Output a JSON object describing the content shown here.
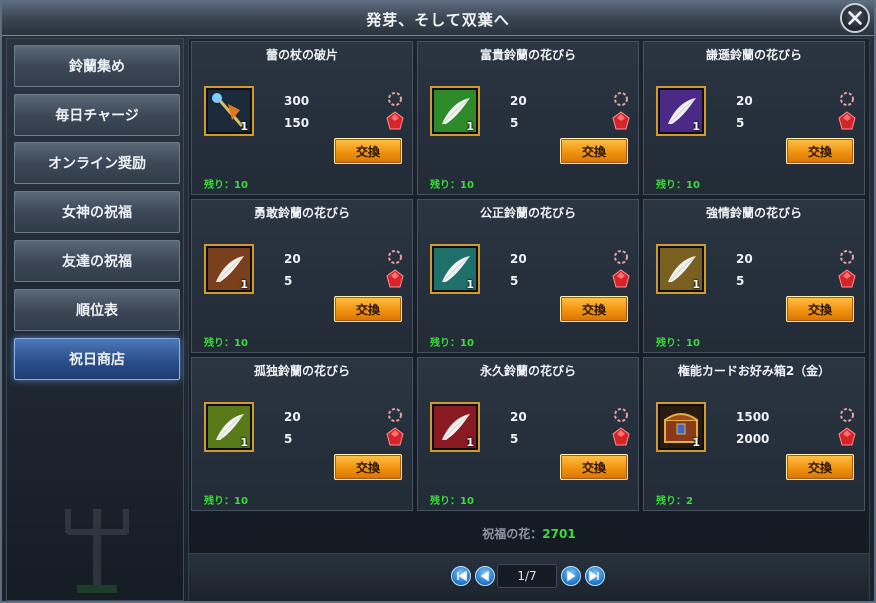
{
  "window": {
    "title": "発芽、そして双葉へ"
  },
  "sidebar": {
    "items": [
      {
        "label": "鈴蘭集め",
        "active": false
      },
      {
        "label": "毎日チャージ",
        "active": false
      },
      {
        "label": "オンライン奨励",
        "active": false
      },
      {
        "label": "女神の祝福",
        "active": false
      },
      {
        "label": "友達の祝福",
        "active": false
      },
      {
        "label": "順位表",
        "active": false
      },
      {
        "label": "祝日商店",
        "active": true
      }
    ]
  },
  "shop": {
    "exchange_label": "交換",
    "items": [
      {
        "title": "蕾の杖の破片",
        "icon": "staff-shard-icon",
        "qty": "1",
        "cost_petals": "300",
        "cost_gems": "150",
        "remaining": "残り：10"
      },
      {
        "title": "富貴鈴蘭の花びら",
        "icon": "green-petal-icon",
        "qty": "1",
        "cost_petals": "20",
        "cost_gems": "5",
        "remaining": "残り：10"
      },
      {
        "title": "謙遜鈴蘭の花びら",
        "icon": "purple-petal-icon",
        "qty": "1",
        "cost_petals": "20",
        "cost_gems": "5",
        "remaining": "残り：10"
      },
      {
        "title": "勇敢鈴蘭の花びら",
        "icon": "brown-petal-icon",
        "qty": "1",
        "cost_petals": "20",
        "cost_gems": "5",
        "remaining": "残り：10"
      },
      {
        "title": "公正鈴蘭の花びら",
        "icon": "teal-petal-icon",
        "qty": "1",
        "cost_petals": "20",
        "cost_gems": "5",
        "remaining": "残り：10"
      },
      {
        "title": "強情鈴蘭の花びら",
        "icon": "gold-petal-icon",
        "qty": "1",
        "cost_petals": "20",
        "cost_gems": "5",
        "remaining": "残り：10"
      },
      {
        "title": "孤独鈴蘭の花びら",
        "icon": "lime-petal-icon",
        "qty": "1",
        "cost_petals": "20",
        "cost_gems": "5",
        "remaining": "残り：10"
      },
      {
        "title": "永久鈴蘭の花びら",
        "icon": "red-petal-icon",
        "qty": "1",
        "cost_petals": "20",
        "cost_gems": "5",
        "remaining": "残り：10"
      },
      {
        "title": "権能カードお好み箱2（金）",
        "icon": "treasure-chest-icon",
        "qty": "1",
        "cost_petals": "1500",
        "cost_gems": "2000",
        "remaining": "残り：2"
      }
    ]
  },
  "footer": {
    "flower_label": "祝福の花：",
    "flower_value": "2701",
    "page": "1/7"
  },
  "colors": {
    "accent_orange": "#f0930e",
    "remaining_green": "#3cdc3c",
    "active_tab_blue": "#2b4f8a",
    "slot_border_gold": "#d29a2a"
  }
}
